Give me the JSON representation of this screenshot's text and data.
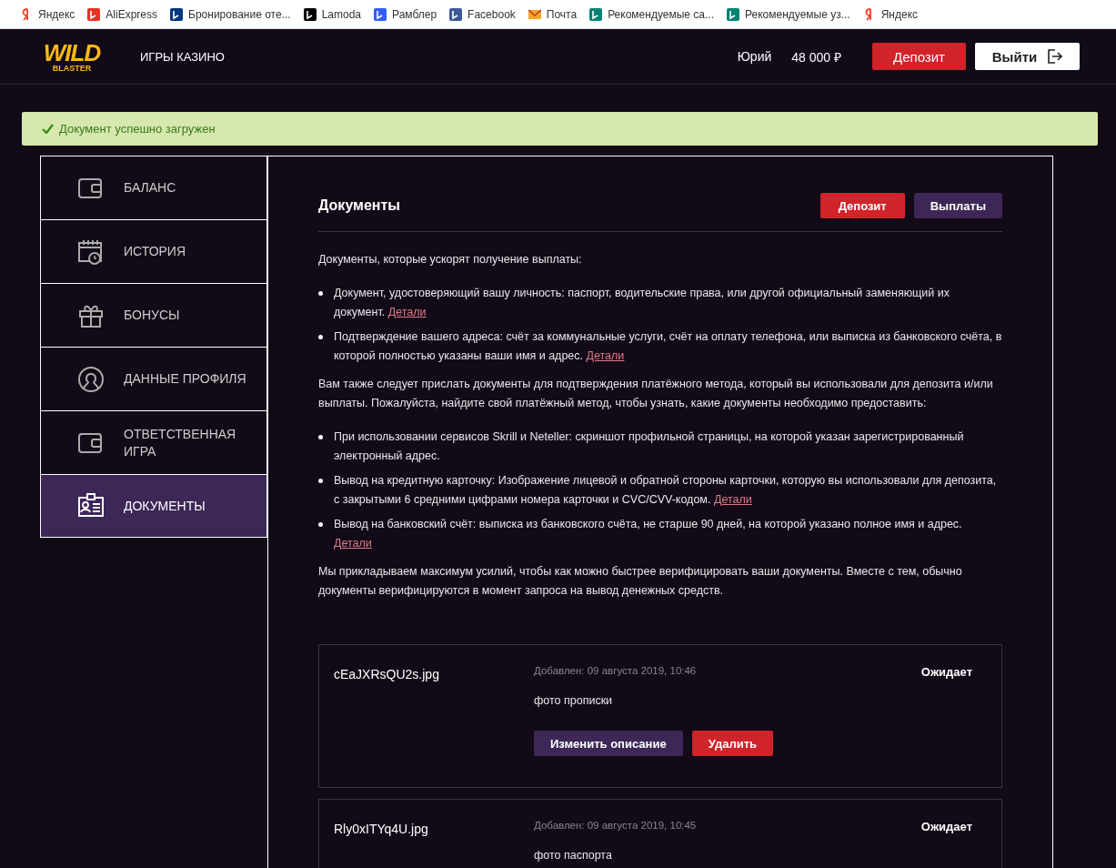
{
  "bookmarks": [
    {
      "kind": "yandex",
      "label": "Яндекс"
    },
    {
      "kind": "aliexpress",
      "label": "AliExpress"
    },
    {
      "kind": "booking",
      "label": "Бронирование оте..."
    },
    {
      "kind": "lamoda",
      "label": "Lamoda"
    },
    {
      "kind": "rambler",
      "label": "Рамблер"
    },
    {
      "kind": "facebook",
      "label": "Facebook"
    },
    {
      "kind": "mail",
      "label": "Почта"
    },
    {
      "kind": "bing",
      "label": "Рекомендуемые са..."
    },
    {
      "kind": "bing",
      "label": "Рекомендуемые уз..."
    },
    {
      "kind": "yandex",
      "label": "Яндекс"
    }
  ],
  "header": {
    "logo_top": "WILD",
    "logo_bottom": "BLASTER",
    "nav": "ИГРЫ КАЗИНО",
    "user": "Юрий",
    "balance": "48 000 ₽",
    "deposit": "Депозит",
    "logout": "Выйти"
  },
  "alert": {
    "text": "Документ успешно загружен"
  },
  "sidebar": {
    "items": [
      {
        "kind": "wallet",
        "label": "БАЛАНС",
        "selected": false
      },
      {
        "kind": "calendar",
        "label": "ИСТОРИЯ",
        "selected": false
      },
      {
        "kind": "gift",
        "label": "БОНУСЫ",
        "selected": false
      },
      {
        "kind": "profile",
        "label": "ДАННЫЕ ПРОФИЛЯ",
        "selected": false
      },
      {
        "kind": "wallet",
        "label": "ОТВЕТСТВЕННАЯ ИГРА",
        "selected": false
      },
      {
        "kind": "idcard",
        "label": "ДОКУМЕНТЫ",
        "selected": true
      }
    ]
  },
  "content": {
    "title": "Документы",
    "deposit": "Депозит",
    "payouts": "Выплаты",
    "blocks": [
      {
        "kind": "paragraph",
        "text": "Документы, которые ускорят получение выплаты:"
      },
      {
        "kind": "list",
        "items": [
          {
            "text": "Документ, удостоверяющий вашу личность: паспорт, водительские права, или другой официальный заменяющий их документ.",
            "link": "Детали"
          },
          {
            "text": "Подтверждение вашего адреса: счёт за коммунальные услуги, счёт на оплату телефона, или выписка из банковского счёта, в которой полностью указаны ваши имя и адрес.",
            "link": "Детали"
          }
        ]
      },
      {
        "kind": "paragraph",
        "text": "Вам также следует прислать документы для подтверждения платёжного метода, который вы использовали для депозита и/или выплаты. Пожалуйста, найдите свой платёжный метод, чтобы узнать, какие документы необходимо предоставить:"
      },
      {
        "kind": "list",
        "items": [
          {
            "text": "При использовании сервисов Skrill и Neteller: скриншот профильной страницы, на которой указан зарегистрированный электронный адрес."
          },
          {
            "text": "Вывод на кредитную карточку: Изображение лицевой и обратной стороны карточки, которую вы использовали для депозита, с закрытыми 6 средними цифрами номера карточки и CVC/CVV-кодом.",
            "link": "Детали"
          },
          {
            "text": "Вывод на банковский счёт: выписка из банковского счёта, не старше 90 дней, на которой указано полное имя и адрес.",
            "link": "Детали"
          }
        ]
      },
      {
        "kind": "paragraph",
        "text": "Мы прикладываем максимум усилий, чтобы как можно быстрее верифицировать ваши документы. Вместе с тем, обычно документы верифицируются в момент запроса на вывод денежных средств."
      }
    ],
    "documents": [
      {
        "filename": "cEaJXRsQU2s.jpg",
        "added": "Добавлен: 09 августа 2019, 10:46",
        "description": "фото прописки",
        "status": "Ожидает",
        "edit": "Изменить описание",
        "delete": "Удалить"
      },
      {
        "filename": "Rly0xITYq4U.jpg",
        "added": "Добавлен: 09 августа 2019, 10:45",
        "description": "фото паспорта",
        "status": "Ожидает"
      }
    ]
  }
}
